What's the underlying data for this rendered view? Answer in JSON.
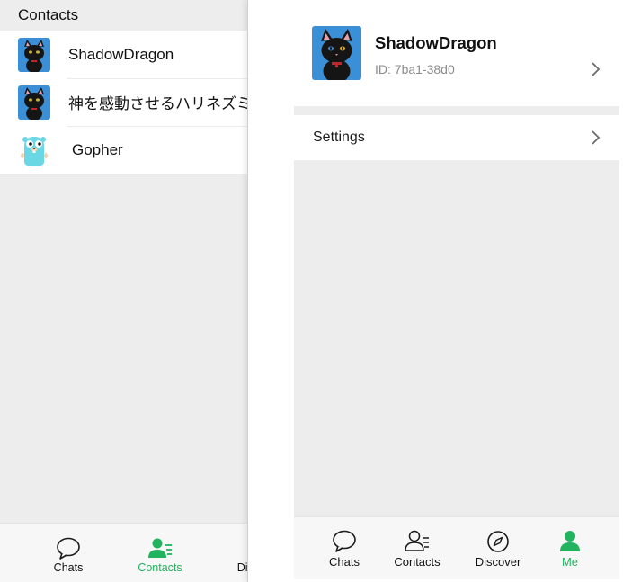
{
  "background": {
    "header_title": "Contacts",
    "contacts": [
      {
        "name": "ShadowDragon",
        "avatar": "black-cat-avatar"
      },
      {
        "name": "神を感動させるハリネズミ",
        "avatar": "black-cat-avatar"
      },
      {
        "name": "Gopher",
        "avatar": "gopher-avatar"
      }
    ],
    "tabs": [
      {
        "label": "Chats",
        "icon": "chat-bubble-icon"
      },
      {
        "label": "Contacts",
        "icon": "contacts-icon",
        "active": true
      },
      {
        "label": "Discover",
        "icon": "compass-icon"
      }
    ]
  },
  "foreground": {
    "profile": {
      "name": "ShadowDragon",
      "id_label": "ID: 7ba1-38d0",
      "avatar": "black-cat-avatar"
    },
    "settings_label": "Settings",
    "tabs": [
      {
        "label": "Chats",
        "icon": "chat-bubble-icon"
      },
      {
        "label": "Contacts",
        "icon": "contacts-icon"
      },
      {
        "label": "Discover",
        "icon": "compass-icon"
      },
      {
        "label": "Me",
        "icon": "person-icon",
        "active": true
      }
    ]
  },
  "colors": {
    "accent": "#22b35e",
    "page_bg": "#ededed",
    "card_bg": "#ffffff",
    "muted_text": "#8c8c8c"
  }
}
